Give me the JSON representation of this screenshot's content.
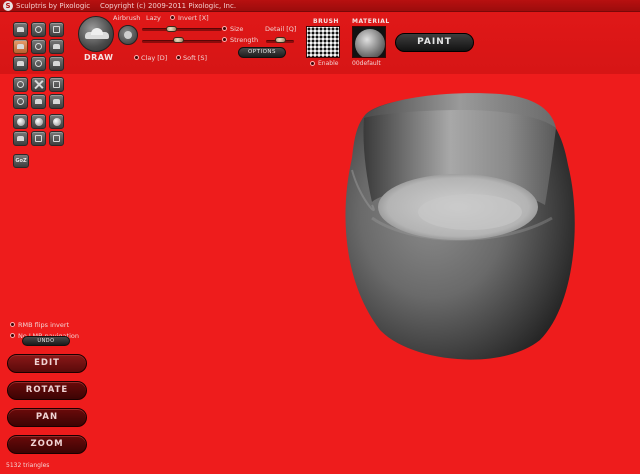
{
  "titlebar": {
    "app_name": "Sculptris by Pixologic",
    "copyright": "Copyright (c) 2009-2011 Pixologic, Inc."
  },
  "tools": {
    "icons": [
      "draw-tool-icon",
      "crease-tool-icon",
      "rotate-tool-icon",
      "flatten-tool-icon",
      "inflate-tool-icon",
      "pinch-tool-icon",
      "grab-tool-icon",
      "smooth-tool-icon",
      "reduce-tool-icon",
      "mirror-icon",
      "delete-icon",
      "wireframe-icon",
      "symmetry-icon",
      "mask-icon",
      "stretch-icon",
      "sphere-icon",
      "plane-icon",
      "lock-icon",
      "import-icon",
      "save-icon",
      "open-icon"
    ],
    "gol_label": "GoZ"
  },
  "brush_panel": {
    "tool_name": "DRAW",
    "airbrush_label": "Airbrush",
    "lazy_label": "Lazy",
    "invert_label": "Invert [X]",
    "size_label": "Size",
    "strength_label": "Strength",
    "detail_label": "Detail [Q]",
    "clay_label": "Clay [D]",
    "soft_label": "Soft [S]",
    "options_label": "OPTIONS",
    "size_value": 0.35,
    "strength_value": 0.45,
    "detail_value": 0.5
  },
  "brush": {
    "title": "BRUSH",
    "enable_label": "Enable"
  },
  "material": {
    "title": "MATERIAL",
    "name": "00default"
  },
  "paint_button": "PAINT",
  "bottom": {
    "rmb_flips_label": "RMB flips invert",
    "no_lmb_label": "No LMB navigation",
    "undo_label": "UNDO",
    "buttons": [
      "EDIT",
      "ROTATE",
      "PAN",
      "ZOOM"
    ],
    "status": "5132 triangles"
  }
}
